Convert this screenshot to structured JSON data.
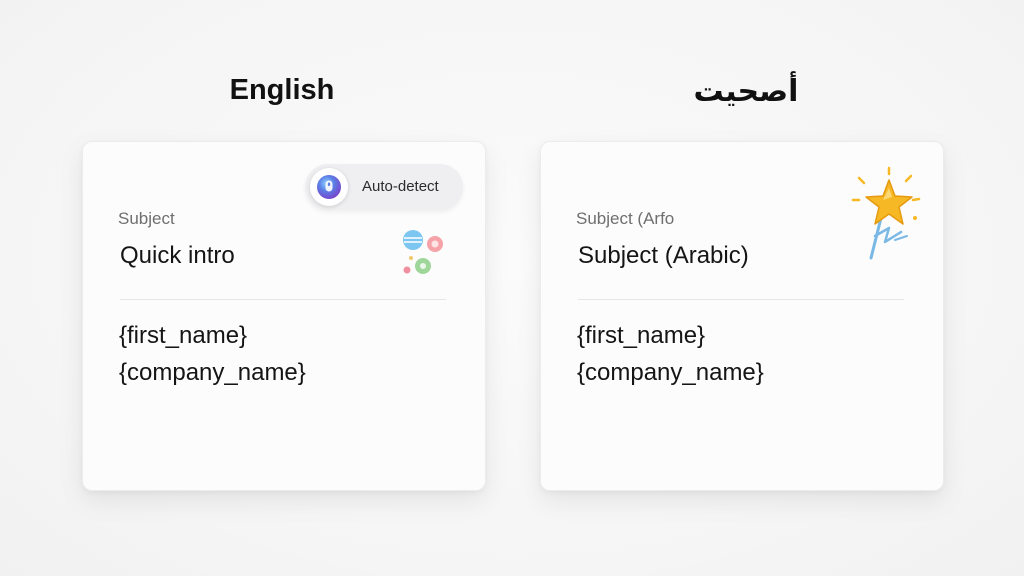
{
  "columns": {
    "left_title": "English",
    "right_title": "أصحيت"
  },
  "left_card": {
    "subject_label": "Subject",
    "subject_value": "Quick intro",
    "placeholder_1": "{first_name}",
    "placeholder_2": "{company_name}",
    "autodetect_label": "Auto-detect",
    "autodetect_icon": "ai-orb-icon",
    "decor_icon": "language-bubbles-icon"
  },
  "right_card": {
    "subject_label": "Subject (Arfo",
    "subject_value": "Subject (Arabic)",
    "placeholder_1": "{first_name}",
    "placeholder_2": "{company_name}",
    "decor_icon": "sparkle-wand-icon"
  },
  "colors": {
    "background": "#f5f5f5",
    "card": "#fcfcfc",
    "text": "#151515",
    "muted": "#6f6f6f",
    "star": "#f7b825",
    "wand": "#7ab8e6"
  }
}
